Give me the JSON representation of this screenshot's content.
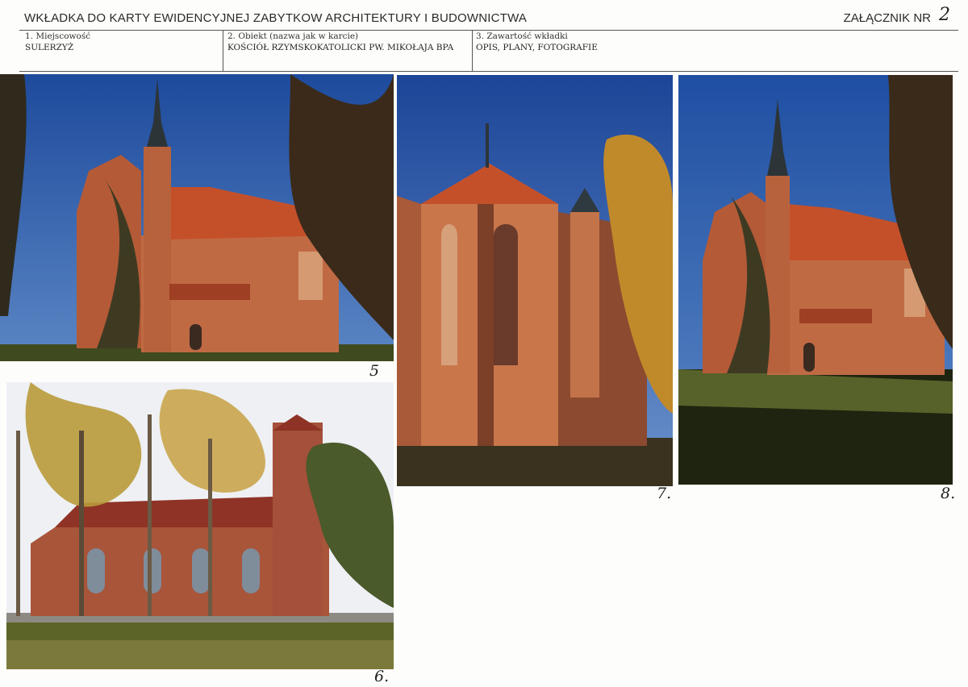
{
  "header": {
    "title": "WKŁADKA DO KARTY EWIDENCYJNEJ ZABYTKOW ARCHITEKTURY I BUDOWNICTWA",
    "annex_label": "ZAŁĄCZNIK NR",
    "annex_number": "2"
  },
  "fields": [
    {
      "label": "1. Miejscowość",
      "value": "SULERZYŻ"
    },
    {
      "label": "2. Obiekt (nazwa jak w karcie)",
      "value": "KOŚCIÓŁ RZYMSKOKATOLICKI PW. MIKOŁAJA BPA"
    },
    {
      "label": "3. Zawartość wkładki",
      "value": "OPIS, PLANY, FOTOGRAFIE"
    }
  ],
  "photos": [
    {
      "number": "5"
    },
    {
      "number": "6."
    },
    {
      "number": "7."
    },
    {
      "number": "8."
    }
  ],
  "colors": {
    "sky": "#2a5aa8",
    "brick": "#b5623e",
    "roof": "#c4502a",
    "grass": "#4a5224"
  }
}
